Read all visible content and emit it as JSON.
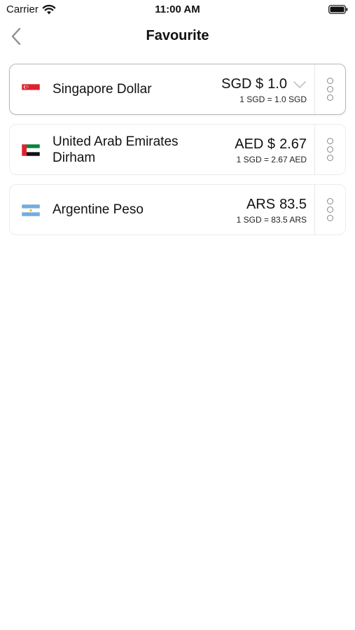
{
  "status_bar": {
    "carrier": "Carrier",
    "time": "11:00 AM"
  },
  "nav": {
    "title": "Favourite",
    "back_icon": "chevron-left-icon"
  },
  "currencies": [
    {
      "name": "Singapore Dollar",
      "amount_symbol": "SGD $",
      "amount_value": "1.0",
      "rate": "1 SGD = 1.0 SGD",
      "flag": "singapore-flag-icon",
      "selected": true
    },
    {
      "name": "United Arab Emirates Dirham",
      "amount_symbol": "AED $",
      "amount_value": "2.67",
      "rate": "1 SGD = 2.67 AED",
      "flag": "uae-flag-icon",
      "selected": false
    },
    {
      "name": "Argentine Peso",
      "amount_symbol": "ARS",
      "amount_value": "83.5",
      "rate": "1 SGD = 83.5 ARS",
      "flag": "argentina-flag-icon",
      "selected": false
    }
  ],
  "colors": {
    "border_selected": "#b9b9b9",
    "border_normal": "#ececec",
    "icon_gray": "#888888"
  }
}
